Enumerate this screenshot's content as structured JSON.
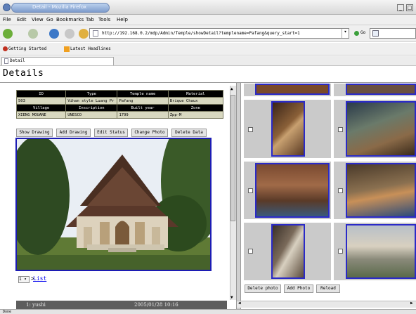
{
  "window": {
    "title": "Detail - Mozilla Firefox",
    "min_label": "_",
    "max_label": "□"
  },
  "menu": [
    "File",
    "Edit",
    "View",
    "Go",
    "Bookmarks",
    "Tab",
    "Tools",
    "Help"
  ],
  "nav": {
    "url": "http://192.168.0.2/mdp/Admin/Temple/showDetail?templename=Pafang&query_start=1",
    "go_label": "Go"
  },
  "bookmarks": [
    "Getting Started",
    "Latest Headlines"
  ],
  "tab": {
    "label": "Detail"
  },
  "page": {
    "title": "Details"
  },
  "info_table": {
    "headers1": [
      "ID",
      "Type",
      "Temple name",
      "Material"
    ],
    "values1": [
      "503",
      "Vihan style Luang Pr",
      "Pafang",
      "Brique Chaux"
    ],
    "headers2": [
      "Village",
      "Inscription",
      "Built year",
      "Zone"
    ],
    "values2": [
      "XIENG MOUANE",
      "UNESCO",
      "1799",
      "Zpp-M"
    ]
  },
  "actions": [
    "Show Drawing",
    "Add Drawing",
    "Edit Status",
    "Change Photo",
    "Delete Data"
  ],
  "pager": {
    "value": "1",
    "list_label": "List"
  },
  "status_strip": {
    "user": "1: yushi",
    "datetime": "2005/01/28 10:16"
  },
  "gallery_actions": [
    "Delete photo",
    "Add Photo",
    "Reload"
  ],
  "statusbar": {
    "text": "Done"
  },
  "colors": {
    "thumb_border": "#2a2ac8",
    "link": "#0000ee",
    "table_header": "#000000",
    "table_cell": "#d8d8c0"
  }
}
